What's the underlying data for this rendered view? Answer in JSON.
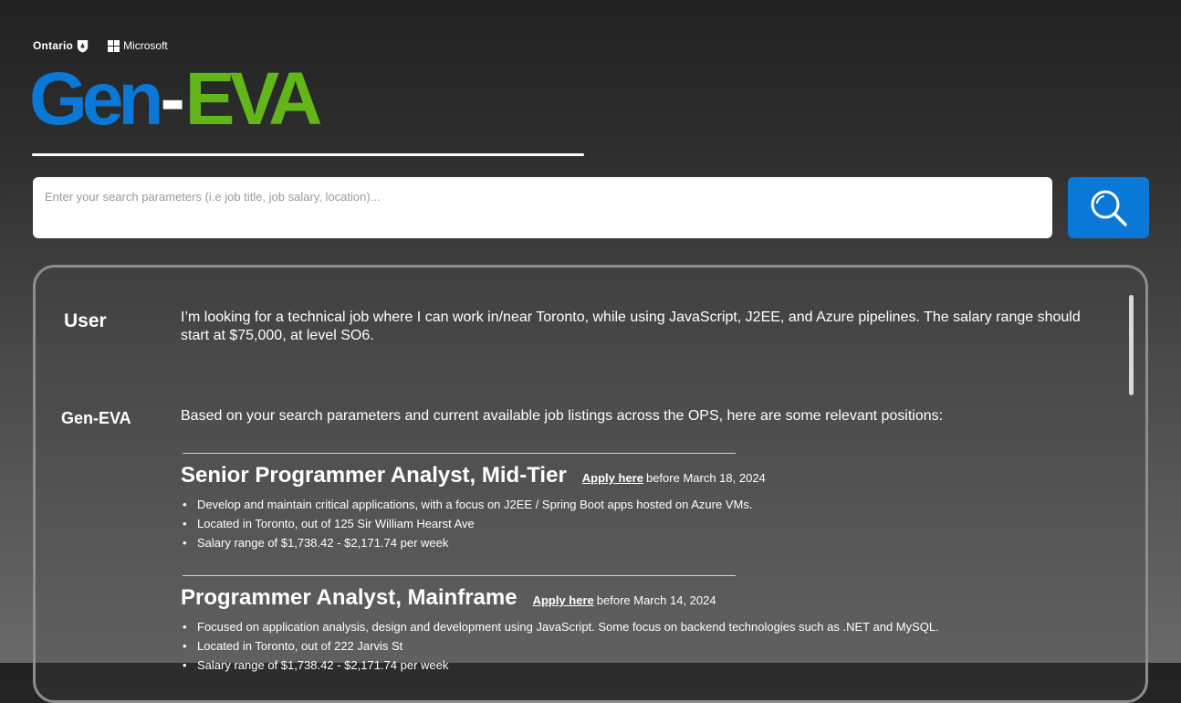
{
  "header": {
    "partner_ontario": "Ontario",
    "partner_microsoft": "Microsoft",
    "brand_gen": "Gen",
    "brand_dash": "-",
    "brand_eva": "EVA"
  },
  "colors": {
    "brand_blue": "#0a78d6",
    "brand_green": "#63b61a",
    "search_button": "#0a78d6"
  },
  "search": {
    "placeholder": "Enter your search parameters (i.e job title, job salary, location)...",
    "value": "",
    "button_icon": "search-icon"
  },
  "chat": {
    "user_label": "User",
    "user_message": "I’m looking for a technical job where I can work in/near Toronto, while using JavaScript, J2EE, and Azure pipelines. The salary range should start at $75,000, at level SO6.",
    "bot_label": "Gen-EVA",
    "bot_message": "Based on your search parameters and current available job listings across the OPS, here are some relevant positions:",
    "jobs": [
      {
        "title": "Senior Programmer Analyst, Mid-Tier",
        "apply_label": "Apply here",
        "deadline": "before March 18, 2024",
        "bullets": [
          "Develop and maintain critical applications, with a focus on J2EE / Spring Boot apps hosted on Azure VMs.",
          "Located in Toronto, out of 125 Sir William Hearst Ave",
          "Salary range of $1,738.42 - $2,171.74 per week"
        ]
      },
      {
        "title": "Programmer Analyst, Mainframe",
        "apply_label": "Apply here",
        "deadline": "before March 14, 2024",
        "bullets": [
          "Focused on application analysis, design and development using JavaScript. Some focus on backend technologies such as .NET and MySQL.",
          "Located in Toronto, out of 222 Jarvis St",
          "Salary range of $1,738.42 - $2,171.74 per week"
        ]
      }
    ]
  }
}
